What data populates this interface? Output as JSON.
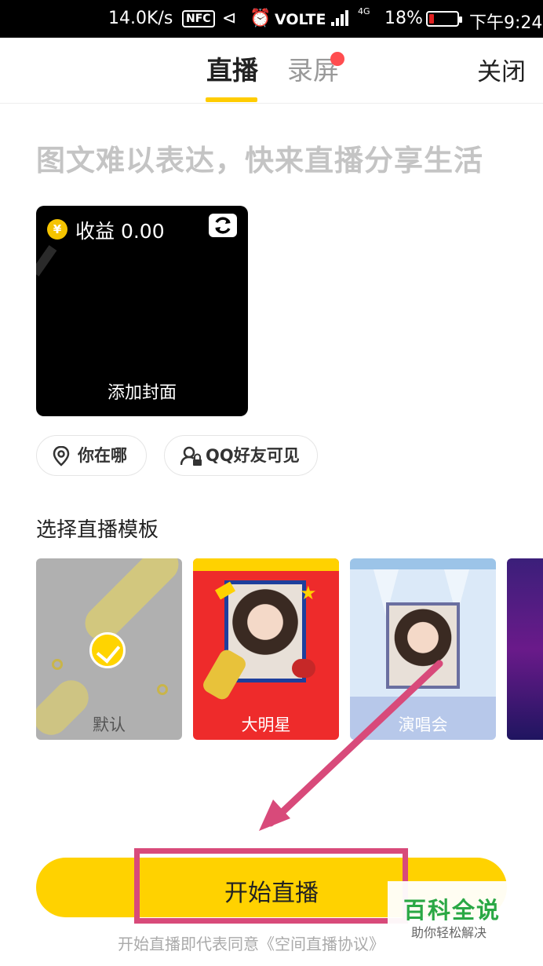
{
  "status_bar": {
    "speed": "14.0K/s",
    "nfc": "NFC",
    "volte": "VOLTE",
    "network": "4G",
    "battery": "18%",
    "battery_level": 0.18,
    "time": "下午9:24"
  },
  "nav": {
    "tabs": [
      {
        "label": "直播",
        "active": true
      },
      {
        "label": "录屏",
        "active": false,
        "badge": true
      }
    ],
    "close_label": "关闭"
  },
  "headline": "图文难以表达，快来直播分享生活",
  "cover": {
    "earnings_label": "收益 0.00",
    "coin_symbol": "¥",
    "add_cover_label": "添加封面"
  },
  "options": {
    "location_label": "你在哪",
    "visibility_label": "QQ好友可见"
  },
  "templates": {
    "section_title": "选择直播模板",
    "items": [
      {
        "label": "默认",
        "selected": true
      },
      {
        "label": "大明星",
        "selected": false
      },
      {
        "label": "演唱会",
        "selected": false
      }
    ]
  },
  "start_button": {
    "label": "开始直播"
  },
  "agreement_text": "开始直播即代表同意《空间直播协议》",
  "watermark": {
    "title": "百科全说",
    "subtitle": "助你轻松解决"
  },
  "colors": {
    "accent": "#ffd200",
    "highlight": "#d84a7a",
    "badge": "#ff4d4f"
  }
}
